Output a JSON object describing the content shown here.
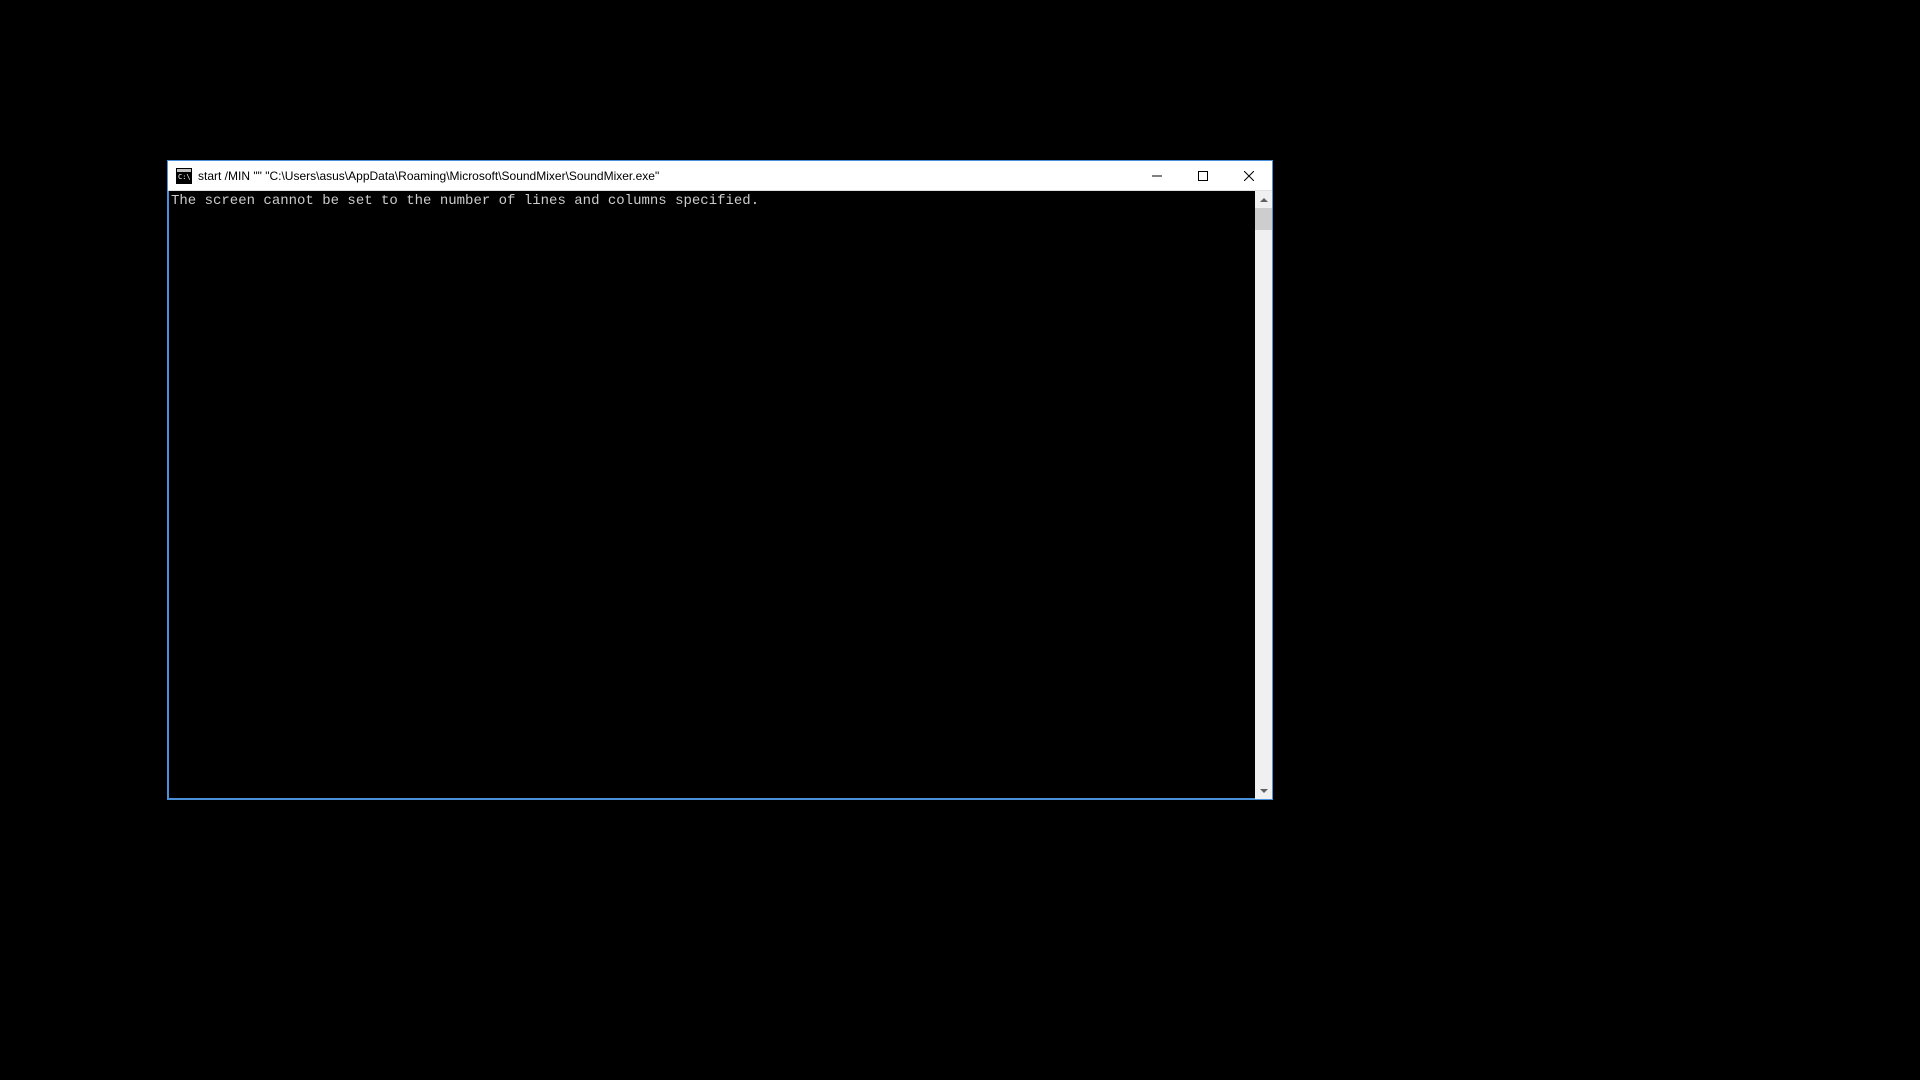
{
  "window": {
    "title": "start  /MIN \"\" \"C:\\Users\\asus\\AppData\\Roaming\\Microsoft\\SoundMixer\\SoundMixer.exe\"",
    "icon": "cmd-icon"
  },
  "console": {
    "lines": [
      "The screen cannot be set to the number of lines and columns specified."
    ]
  }
}
